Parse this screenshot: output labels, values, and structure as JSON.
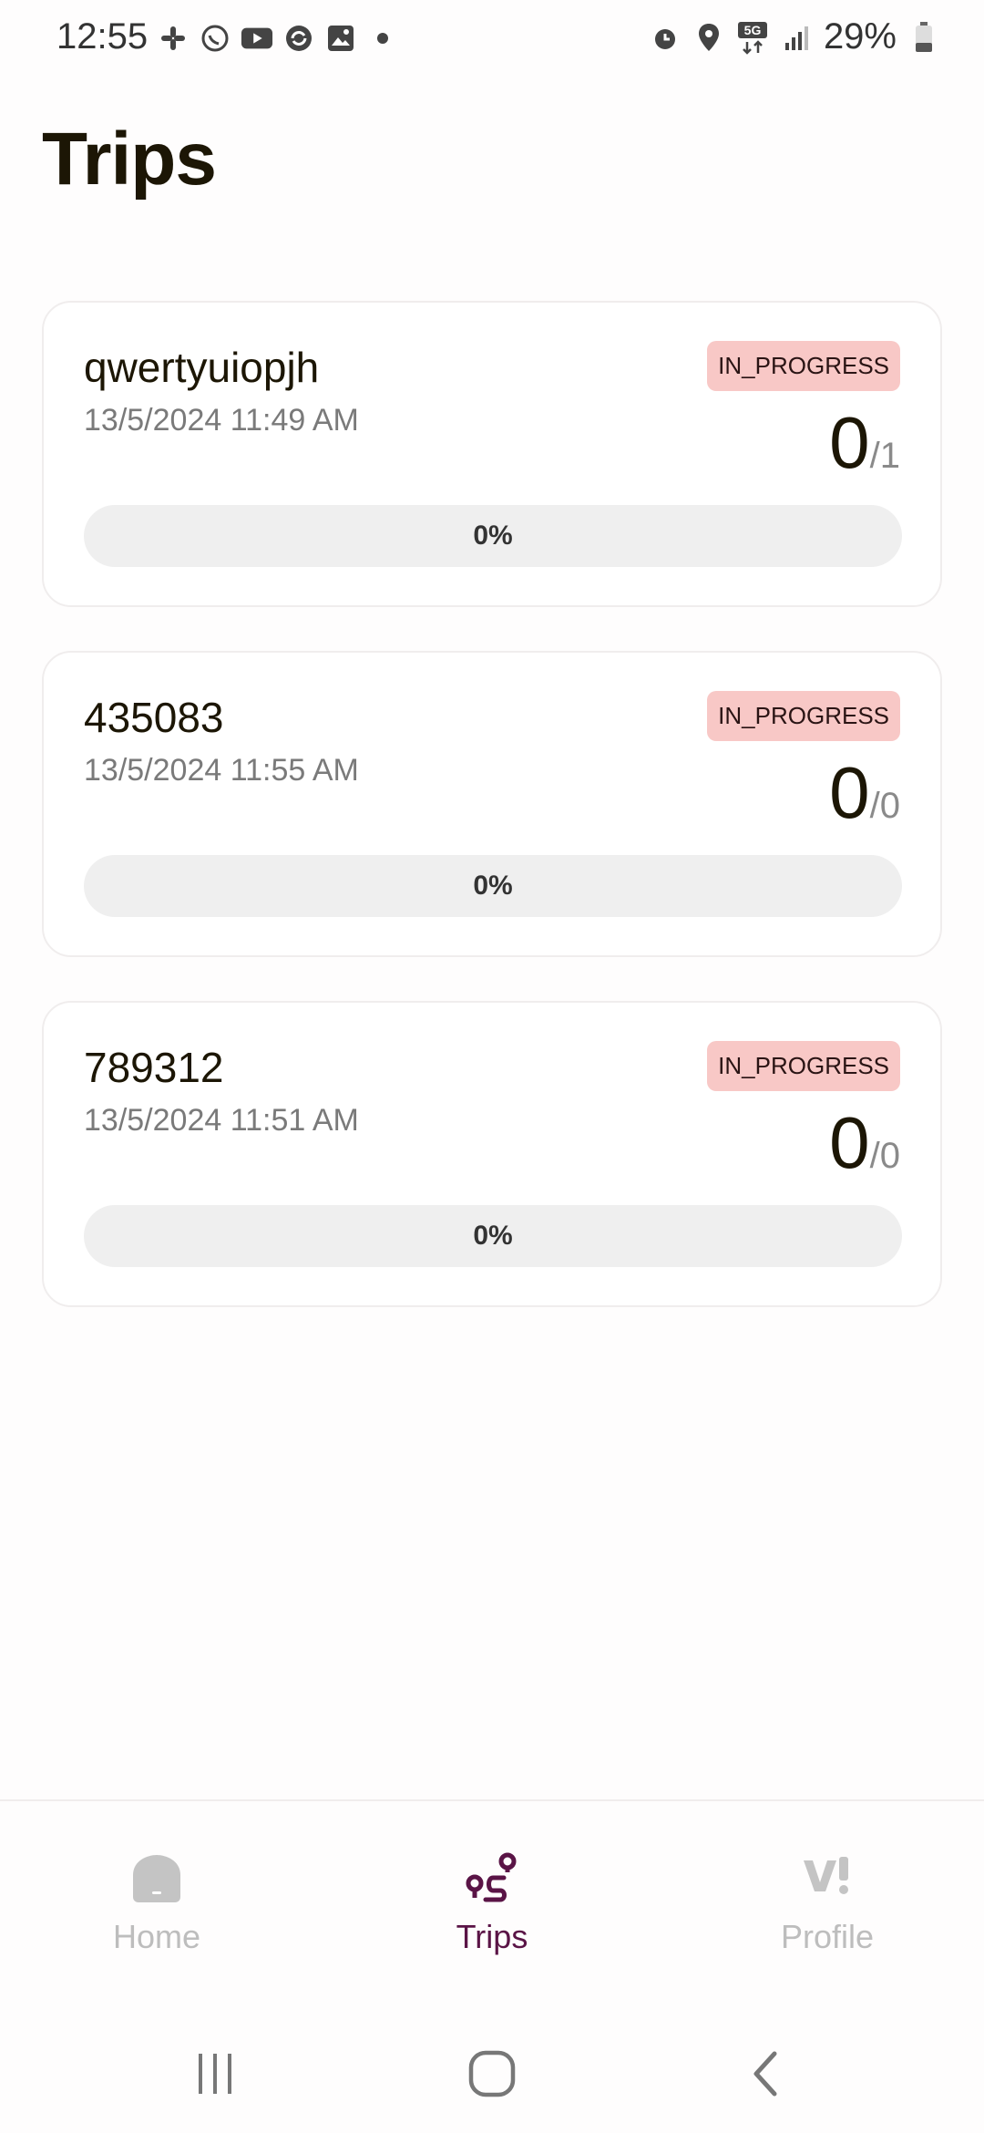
{
  "status_bar": {
    "time": "12:55",
    "left_icons": [
      "slack-icon",
      "whatsapp-icon",
      "youtube-icon",
      "sync-icon",
      "gallery-icon",
      "dot-icon"
    ],
    "right_icons": [
      "alarm-icon",
      "location-icon",
      "5g-icon",
      "signal-icon",
      "battery-icon"
    ],
    "battery": "29%"
  },
  "page": {
    "title": "Trips"
  },
  "trips": [
    {
      "name": "qwertyuiopjh",
      "date": "13/5/2024 11:49 AM",
      "status": "IN_PROGRESS",
      "done": "0",
      "total": "/1",
      "progress_label": "0%",
      "progress": 0
    },
    {
      "name": "435083",
      "date": "13/5/2024 11:55 AM",
      "status": "IN_PROGRESS",
      "done": "0",
      "total": "/0",
      "progress_label": "0%",
      "progress": 0
    },
    {
      "name": "789312",
      "date": "13/5/2024 11:51 AM",
      "status": "IN_PROGRESS",
      "done": "0",
      "total": "/0",
      "progress_label": "0%",
      "progress": 0
    }
  ],
  "bottom_nav": {
    "items": [
      {
        "label": "Home",
        "icon": "home-icon",
        "active": false
      },
      {
        "label": "Trips",
        "icon": "route-icon",
        "active": true
      },
      {
        "label": "Profile",
        "icon": "vi-logo-icon",
        "active": false
      }
    ]
  },
  "system_nav": [
    "recents-icon",
    "home-circle-icon",
    "back-icon"
  ],
  "colors": {
    "accent": "#5a1446",
    "badge_bg": "#f8c8c6",
    "inactive": "#bdbdbd"
  }
}
